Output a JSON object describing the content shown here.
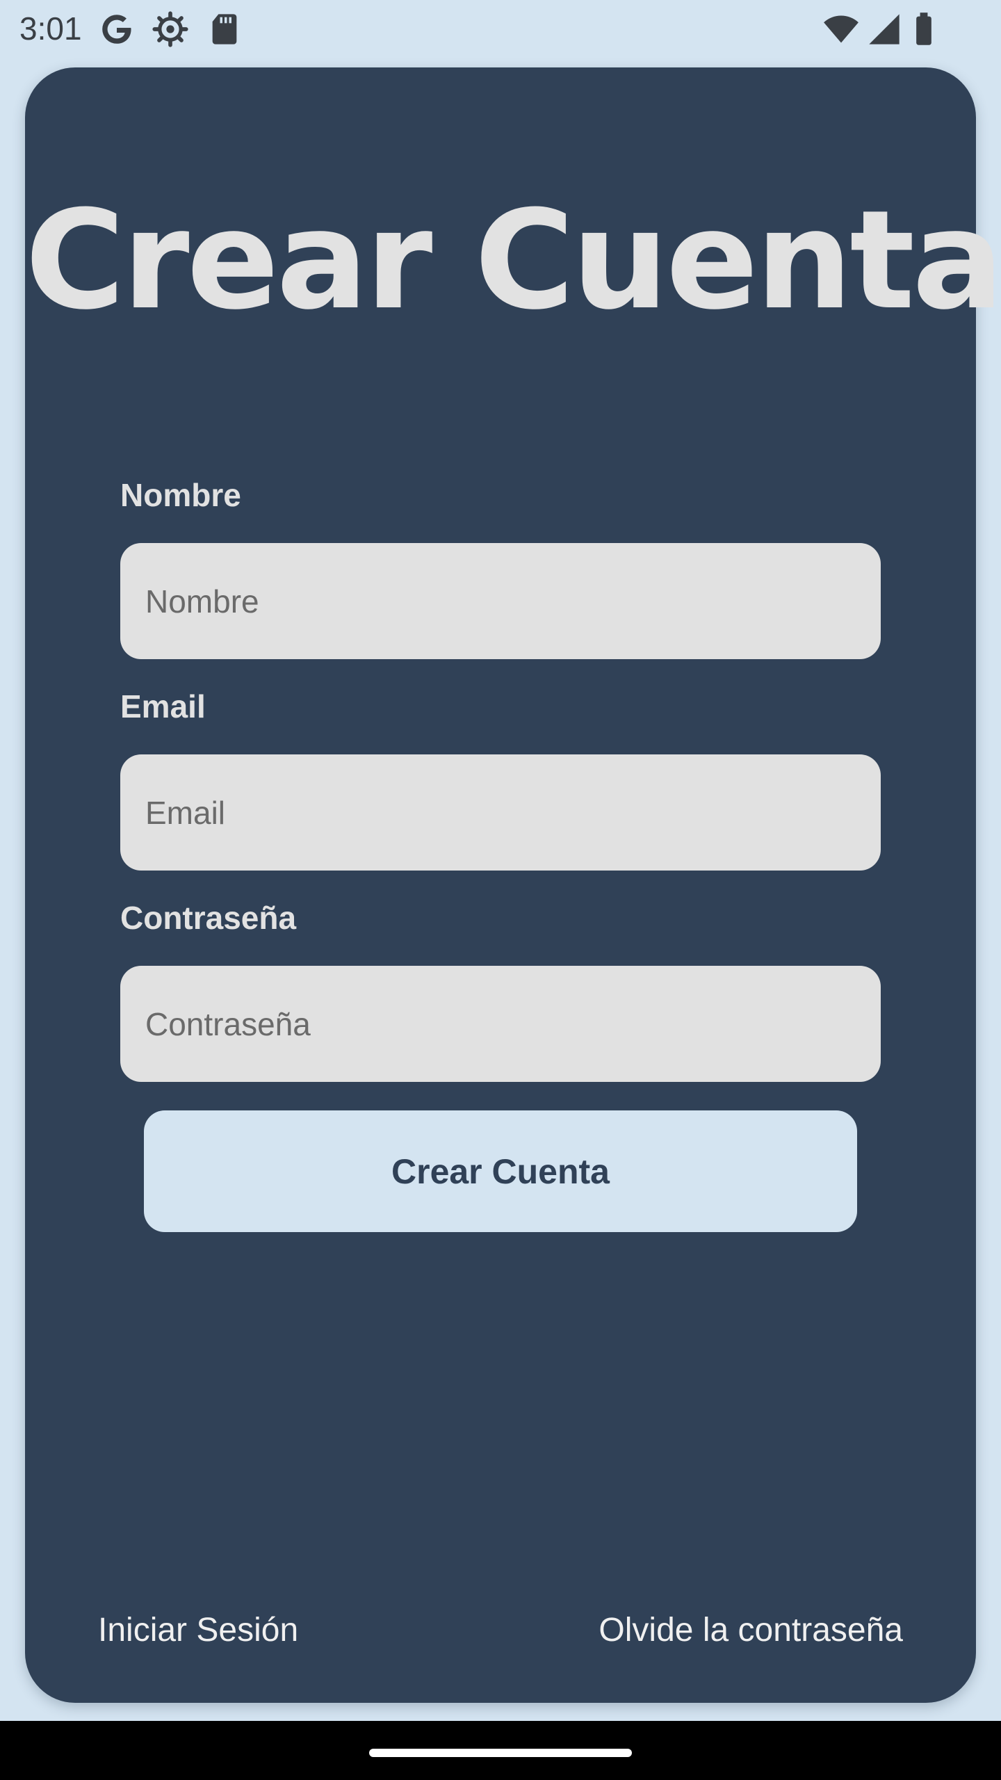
{
  "status_bar": {
    "time": "3:01",
    "left_icons": [
      "google-icon",
      "settings-icon",
      "sd-card-icon"
    ],
    "right_icons": [
      "wifi-icon",
      "signal-icon",
      "battery-icon"
    ]
  },
  "form": {
    "title": "Crear Cuenta",
    "fields": [
      {
        "label": "Nombre",
        "placeholder": "Nombre",
        "value": ""
      },
      {
        "label": "Email",
        "placeholder": "Email",
        "value": ""
      },
      {
        "label": "Contraseña",
        "placeholder": "Contraseña",
        "value": ""
      }
    ],
    "submit_label": "Crear Cuenta"
  },
  "footer": {
    "login_link": "Iniciar Sesión",
    "forgot_link": "Olvide la contraseña"
  },
  "colors": {
    "background": "#d4e4f1",
    "card": "#304157",
    "input": "#e1e1e1",
    "button": "#d4e4f1",
    "button_text": "#304157",
    "label": "#e2e2e2"
  }
}
